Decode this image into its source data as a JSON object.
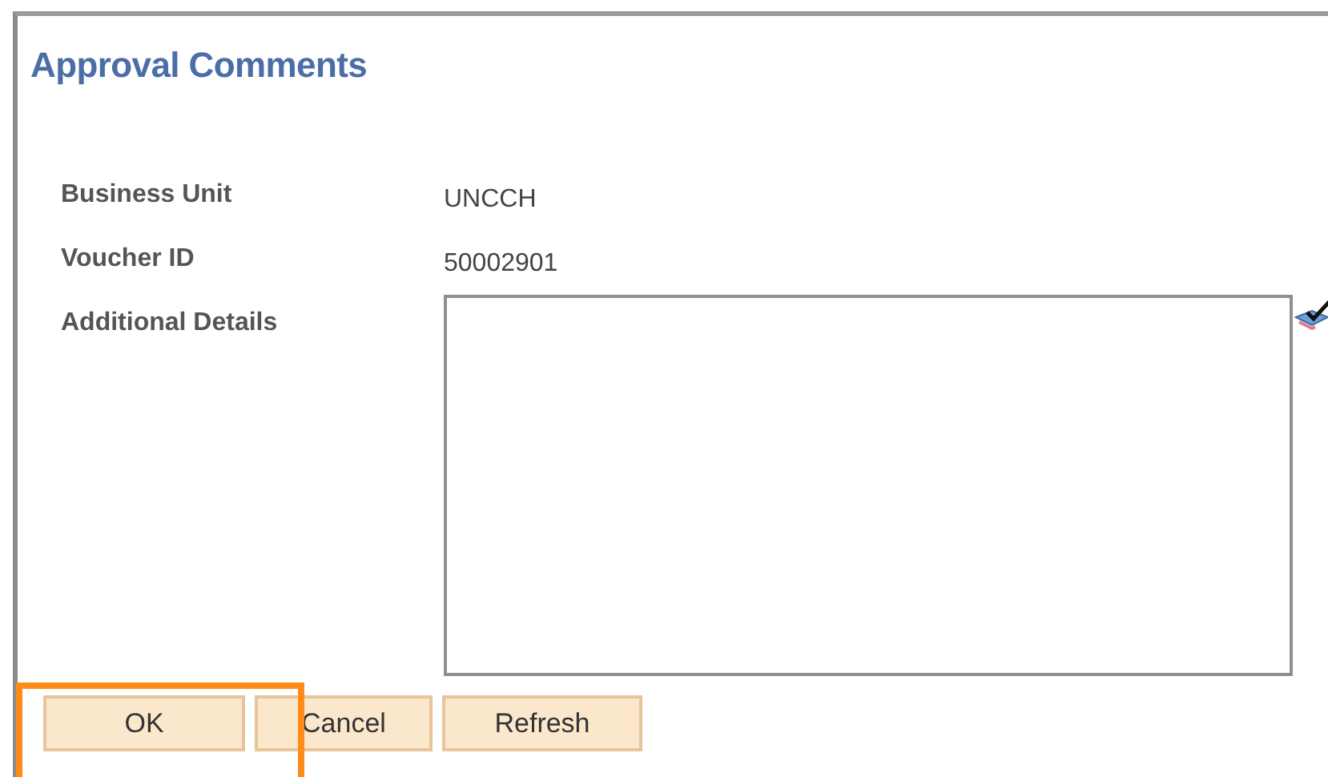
{
  "title": "Approval Comments",
  "fields": [
    {
      "label": "Business Unit",
      "value": "UNCCH"
    },
    {
      "label": "Voucher ID",
      "value": "50002901"
    }
  ],
  "details": {
    "label": "Additional Details"
  },
  "buttons": [
    {
      "label": "OK",
      "highlighted": true
    },
    {
      "label": "Cancel",
      "highlighted": false
    },
    {
      "label": "Refresh",
      "highlighted": false
    }
  ]
}
